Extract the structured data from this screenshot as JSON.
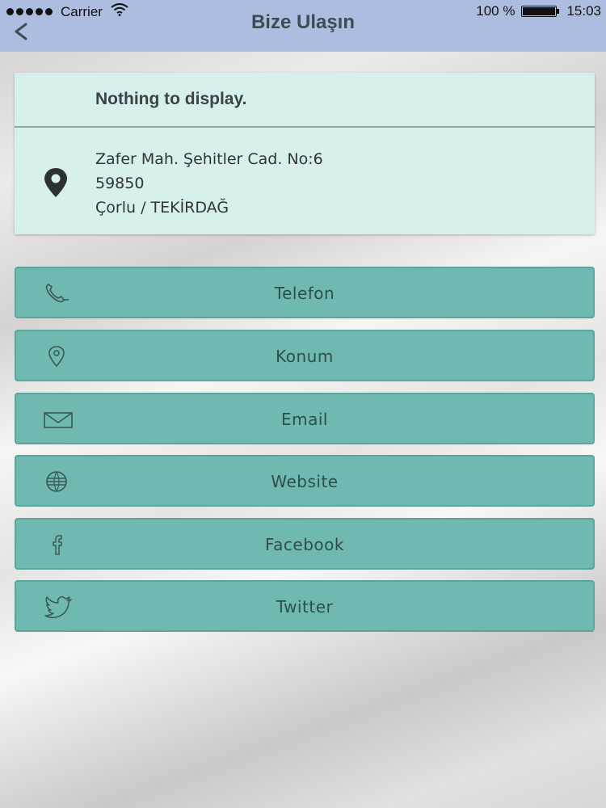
{
  "status_bar": {
    "carrier": "Carrier",
    "battery_percent": "100 %",
    "time": "15:03",
    "icons": [
      "signal-dots-icon",
      "wifi-icon",
      "battery-icon"
    ]
  },
  "nav": {
    "title": "Bize Ulaşın",
    "back_icon": "chevron-left-icon"
  },
  "info": {
    "empty_text": "Nothing to display.",
    "address_icon": "location-pin-icon",
    "address_line1": "Zafer Mah. Şehitler Cad. No:6",
    "address_line2": "59850",
    "address_line3": "Çorlu / TEKİRDAĞ"
  },
  "buttons": [
    {
      "label": "Telefon",
      "icon": "phone-icon"
    },
    {
      "label": "Konum",
      "icon": "map-pin-icon"
    },
    {
      "label": "Email",
      "icon": "envelope-icon"
    },
    {
      "label": "Website",
      "icon": "globe-icon"
    },
    {
      "label": "Facebook",
      "icon": "facebook-icon"
    },
    {
      "label": "Twitter",
      "icon": "twitter-icon"
    }
  ],
  "colors": {
    "bar": "#adbde0",
    "card": "#d7efed",
    "button": "#6fb9b0",
    "button_text": "#2e4e4c"
  }
}
